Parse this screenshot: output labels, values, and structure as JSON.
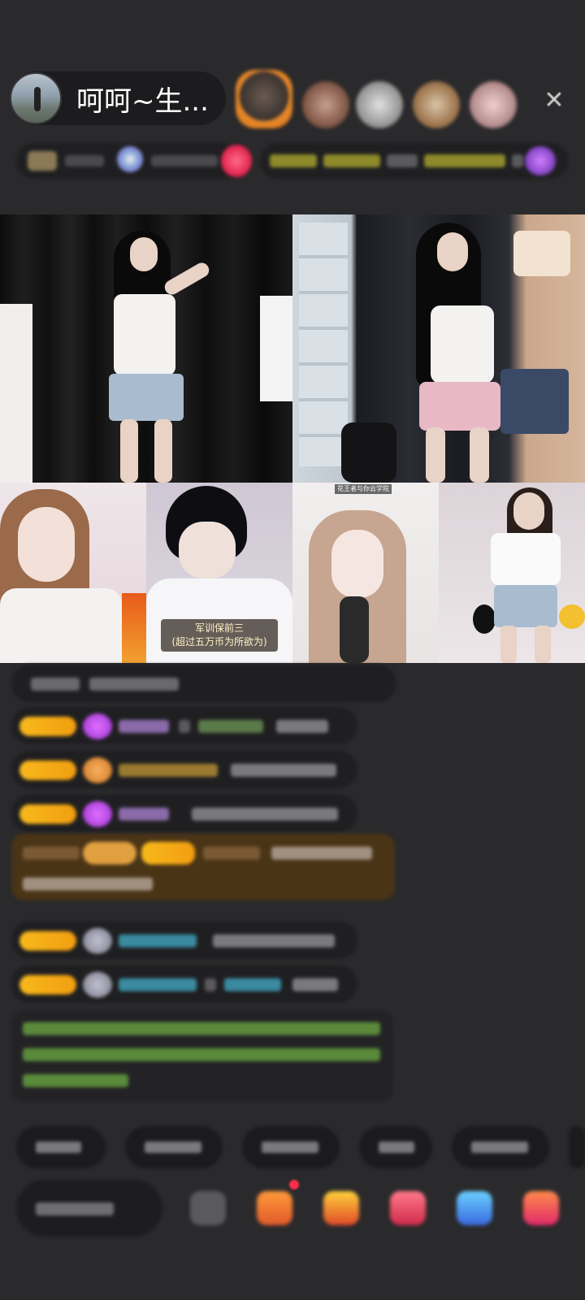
{
  "header": {
    "host_name": "呵呵~生...",
    "close_icon": "close-icon"
  },
  "video_grid": {
    "caption_line1": "军训保前三",
    "caption_line2": "(超过五万币为所欲为)",
    "tile_tag": "花王者与你云学院"
  },
  "colors": {
    "background": "#2a2a2c",
    "level_badge": "#f7b91c",
    "highlight_message": "#4a3416",
    "notification_dot": "#ff2e4a"
  }
}
